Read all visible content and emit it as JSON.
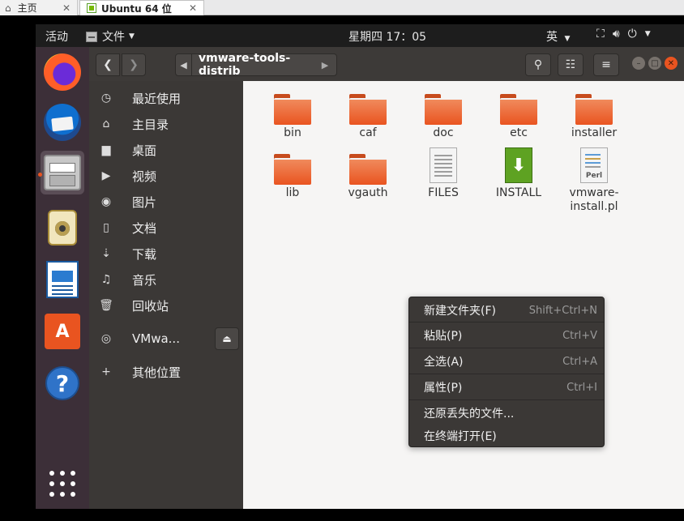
{
  "host": {
    "tab_home": "主页",
    "tab_vm": "Ubuntu 64 位"
  },
  "topbar": {
    "activities": "活动",
    "app_menu": "文件",
    "clock": "星期四 17：05",
    "lang": "英"
  },
  "header": {
    "path": "vmware-tools-distrib"
  },
  "sidebar": {
    "items": [
      {
        "label": "最近使用"
      },
      {
        "label": "主目录"
      },
      {
        "label": "桌面"
      },
      {
        "label": "视频"
      },
      {
        "label": "图片"
      },
      {
        "label": "文档"
      },
      {
        "label": "下载"
      },
      {
        "label": "音乐"
      },
      {
        "label": "回收站"
      },
      {
        "label": "VMwa..."
      },
      {
        "label": "其他位置"
      }
    ]
  },
  "files": [
    {
      "name": "bin",
      "kind": "folder"
    },
    {
      "name": "caf",
      "kind": "folder"
    },
    {
      "name": "doc",
      "kind": "folder"
    },
    {
      "name": "etc",
      "kind": "folder"
    },
    {
      "name": "installer",
      "kind": "folder"
    },
    {
      "name": "lib",
      "kind": "folder"
    },
    {
      "name": "vgauth",
      "kind": "folder"
    },
    {
      "name": "FILES",
      "kind": "text-file"
    },
    {
      "name": "INSTALL",
      "kind": "install-file"
    },
    {
      "name": "vmware-\ninstall.pl",
      "kind": "perl-file",
      "perl_label": "Perl"
    }
  ],
  "context_menu": {
    "items": [
      {
        "label": "新建文件夹(F)",
        "shortcut": "Shift+Ctrl+N"
      },
      {
        "label": "粘贴(P)",
        "shortcut": "Ctrl+V"
      },
      {
        "label": "全选(A)",
        "shortcut": "Ctrl+A"
      },
      {
        "label": "属性(P)",
        "shortcut": "Ctrl+I"
      },
      {
        "label": "还原丢失的文件...",
        "shortcut": ""
      },
      {
        "label": "在终端打开(E)",
        "shortcut": ""
      }
    ]
  },
  "colors": {
    "accent": "#e95420",
    "dock_bg": "#3c2f38",
    "sidebar_bg": "#3b3836",
    "content_bg": "#f6f5f4"
  }
}
